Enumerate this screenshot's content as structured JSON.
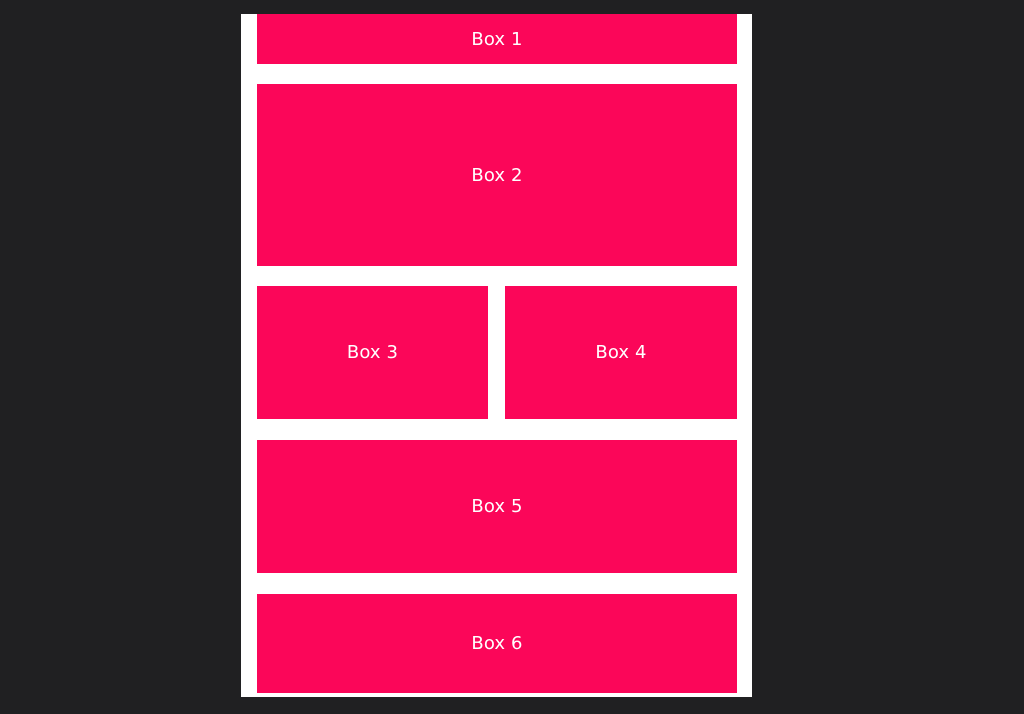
{
  "colors": {
    "background": "#202022",
    "panel": "#ffffff",
    "box": "#fb0659",
    "box_text": "#ffffff"
  },
  "boxes": [
    {
      "label": "Box 1"
    },
    {
      "label": "Box 2"
    },
    {
      "label": "Box 3"
    },
    {
      "label": "Box 4"
    },
    {
      "label": "Box 5"
    },
    {
      "label": "Box 6"
    }
  ]
}
